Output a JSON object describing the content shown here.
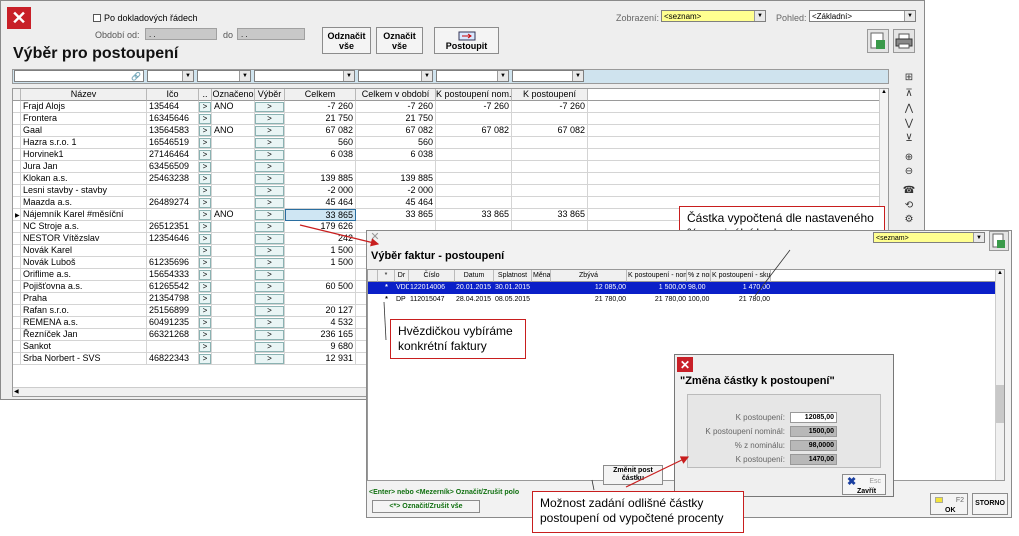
{
  "main": {
    "title": "Výběr pro postoupení",
    "chk_doklad_label": "Po dokladových řádech",
    "obdobi_od_label": "Období od:",
    "obdobi_do_label": "do",
    "obdobi_od_value": ". .",
    "obdobi_do_value": ". .",
    "btn_odznacit": "Odznačit vše",
    "btn_oznacit": "Označit vše",
    "btn_postoupit": "Postoupit",
    "zobrazeni_label": "Zobrazení:",
    "zobrazeni_value": "<seznam>",
    "pohled_label": "Pohled:",
    "pohled_value": "<Základní>",
    "headers": [
      "Název",
      "Ičo",
      "..",
      "Označeno",
      "Výběr",
      "Celkem",
      "Celkem v období",
      "K postoupení nom.",
      "K postoupení"
    ],
    "rows": [
      {
        "nazev": "Frajd Alojs",
        "ico": "135464",
        "oz": "ANO",
        "celkem": "-7 260",
        "obdobi": "-7 260",
        "kpn": "-7 260",
        "kp": "-7 260"
      },
      {
        "nazev": "Frontera",
        "ico": "16345646",
        "oz": "",
        "celkem": "21 750",
        "obdobi": "21 750",
        "kpn": "",
        "kp": ""
      },
      {
        "nazev": "Gaal",
        "ico": "13564583",
        "oz": "ANO",
        "celkem": "67 082",
        "obdobi": "67 082",
        "kpn": "67 082",
        "kp": "67 082"
      },
      {
        "nazev": "Hazra s.r.o.     1",
        "ico": "16546519",
        "oz": "",
        "celkem": "560",
        "obdobi": "560",
        "kpn": "",
        "kp": ""
      },
      {
        "nazev": "Horvinek1",
        "ico": "27146464",
        "oz": "",
        "celkem": "6 038",
        "obdobi": "6 038",
        "kpn": "",
        "kp": ""
      },
      {
        "nazev": "Jura Jan",
        "ico": "63456509",
        "oz": "",
        "celkem": "",
        "obdobi": "",
        "kpn": "",
        "kp": ""
      },
      {
        "nazev": "Klokan a.s.",
        "ico": "25463238",
        "oz": "",
        "celkem": "139 885",
        "obdobi": "139 885",
        "kpn": "",
        "kp": ""
      },
      {
        "nazev": "Lesni stavby - stavby",
        "ico": "",
        "oz": "",
        "celkem": "-2 000",
        "obdobi": "-2 000",
        "kpn": "",
        "kp": ""
      },
      {
        "nazev": "Maazda a.s.",
        "ico": "26489274",
        "oz": "",
        "celkem": "45 464",
        "obdobi": "45 464",
        "kpn": "",
        "kp": ""
      },
      {
        "nazev": "Nájemník Karel #měsíční",
        "ico": "",
        "oz": "ANO",
        "celkem": "33 865",
        "obdobi": "33 865",
        "kpn": "33 865",
        "kp": "33 865"
      },
      {
        "nazev": "NC Stroje a.s.",
        "ico": "26512351",
        "oz": "",
        "celkem": "179 626",
        "obdobi": "",
        "kpn": "",
        "kp": ""
      },
      {
        "nazev": "NESTOR Vítězslav",
        "ico": "12354646",
        "oz": "",
        "celkem": "242",
        "obdobi": "",
        "kpn": "",
        "kp": ""
      },
      {
        "nazev": "Novák Karel",
        "ico": "",
        "oz": "",
        "celkem": "1 500",
        "obdobi": "",
        "kpn": "",
        "kp": ""
      },
      {
        "nazev": "Novák Luboš",
        "ico": "61235696",
        "oz": "",
        "celkem": "1 500",
        "obdobi": "",
        "kpn": "",
        "kp": ""
      },
      {
        "nazev": "Oriflime a.s.",
        "ico": "15654333",
        "oz": "",
        "celkem": "",
        "obdobi": "",
        "kpn": "",
        "kp": ""
      },
      {
        "nazev": "Pojišťovna a.s.",
        "ico": "61265542",
        "oz": "",
        "celkem": "60 500",
        "obdobi": "",
        "kpn": "",
        "kp": ""
      },
      {
        "nazev": "Praha",
        "ico": "21354798",
        "oz": "",
        "celkem": "",
        "obdobi": "",
        "kpn": "",
        "kp": ""
      },
      {
        "nazev": "Rafan s.r.o.",
        "ico": "25156899",
        "oz": "",
        "celkem": "20 127",
        "obdobi": "",
        "kpn": "",
        "kp": ""
      },
      {
        "nazev": "REMENA a.s.",
        "ico": "60491235",
        "oz": "",
        "celkem": "4 532",
        "obdobi": "",
        "kpn": "",
        "kp": ""
      },
      {
        "nazev": "Řezníček Jan",
        "ico": "66321268",
        "oz": "",
        "celkem": "236 165",
        "obdobi": "",
        "kpn": "",
        "kp": ""
      },
      {
        "nazev": "Sankot",
        "ico": "",
        "oz": "",
        "celkem": "9 680",
        "obdobi": "",
        "kpn": "",
        "kp": ""
      },
      {
        "nazev": "Srba Norbert - SVS",
        "ico": "46822343",
        "oz": "",
        "celkem": "12 931",
        "obdobi": "",
        "kpn": "",
        "kp": ""
      }
    ],
    "row_btn": ">"
  },
  "sub": {
    "title": "Výběr faktur - postoupení",
    "zobrazeni_value": "<seznam>",
    "headers": [
      "*",
      "Dr",
      "Číslo",
      "Datum",
      "Splatnost",
      "Měna",
      "Zbývá",
      "K postoupení - nomi",
      "% z nom",
      "K postoupení - skute"
    ],
    "rows": [
      {
        "star": "*",
        "dr": "VDD",
        "cislo": "122014006",
        "datum": "20.01.2015",
        "splat": "30.01.2015",
        "mena": "",
        "zbyva": "12 085,00",
        "kpn": "1 500,00",
        "pct": "98,00",
        "kps": "1 470,00"
      },
      {
        "star": "*",
        "dr": "DP",
        "cislo": "112015047",
        "datum": "28.04.2015",
        "splat": "08.05.2015",
        "mena": "",
        "zbyva": "21 780,00",
        "kpn": "21 780,00",
        "pct": "100,00",
        "kps": "21 780,00"
      }
    ],
    "btn_zmenit": "Změnit post částku",
    "status_text": "<Enter> nebo <Mezerník> Označit/Zrušit polo",
    "btn_oznacit_vse": "<*> Označit/Zrušit vše",
    "ok_key": "F2",
    "ok_label": "OK",
    "storno_label": "STORNO"
  },
  "dialog": {
    "title": "\"Změna částky k postoupení\"",
    "fields": [
      {
        "label": "K postoupení:",
        "value": "12085,00"
      },
      {
        "label": "K postoupení nominál:",
        "value": "1500,00"
      },
      {
        "label": "% z nominálu:",
        "value": "98,0000"
      },
      {
        "label": "K postoupení:",
        "value": "1470,00"
      }
    ],
    "esc_key": "Esc",
    "zavrit_label": "Zavřít"
  },
  "callouts": {
    "c1": "Částka vypočtená dle nastaveného % nominální hodnoty",
    "c2": "Hvězdičkou vybíráme konkrétní faktury",
    "c3": "Možnost zadání odlišné částky postoupení od vypočtené procenty"
  },
  "colors": {
    "red": "#c81e1e",
    "selection": "#0a1fc8",
    "field_yellow": "#ffff90"
  }
}
